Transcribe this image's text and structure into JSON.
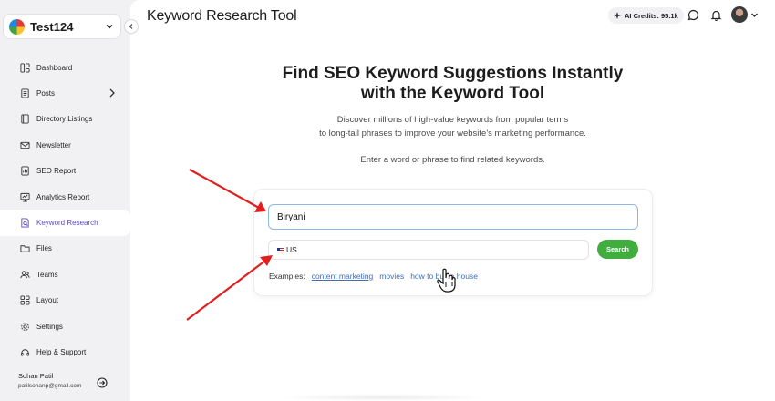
{
  "sidebar": {
    "workspace_name": "Test124",
    "items": [
      {
        "label": "Dashboard",
        "icon": "dashboard-icon"
      },
      {
        "label": "Posts",
        "icon": "posts-icon"
      },
      {
        "label": "Directory Listings",
        "icon": "directory-icon"
      },
      {
        "label": "Newsletter",
        "icon": "mail-icon"
      },
      {
        "label": "SEO Report",
        "icon": "report-icon"
      },
      {
        "label": "Analytics Report",
        "icon": "analytics-icon"
      },
      {
        "label": "Keyword Research",
        "icon": "keyword-icon"
      },
      {
        "label": "Files",
        "icon": "folder-icon"
      },
      {
        "label": "Teams",
        "icon": "teams-icon"
      },
      {
        "label": "Layout",
        "icon": "layout-icon"
      },
      {
        "label": "Settings",
        "icon": "gear-icon"
      },
      {
        "label": "Help & Support",
        "icon": "help-icon"
      }
    ],
    "active_item": "Keyword Research",
    "user": {
      "name": "Sohan Patil",
      "email": "patilsohanp@gmail.com"
    }
  },
  "header": {
    "title": "Keyword Research Tool",
    "credits": "AI Credits: 95.1k"
  },
  "hero": {
    "title_line1": "Find SEO Keyword Suggestions Instantly",
    "title_line2": "with the Keyword Tool",
    "sub_line1": "Discover millions of high-value keywords from popular terms",
    "sub_line2": "to long-tail phrases to improve your website's marketing performance.",
    "hint": "Enter a word or phrase to find related keywords."
  },
  "search": {
    "keyword_value": "Biryani",
    "country_value": "US",
    "button_label": "Search",
    "examples_label": "Examples:",
    "examples": [
      "content marketing",
      "movies",
      "how to buy a house"
    ]
  },
  "colors": {
    "accent": "#5b4bc4",
    "search_button": "#3fae3f",
    "link": "#3f6fb5",
    "annotation_arrow": "#e02020"
  }
}
